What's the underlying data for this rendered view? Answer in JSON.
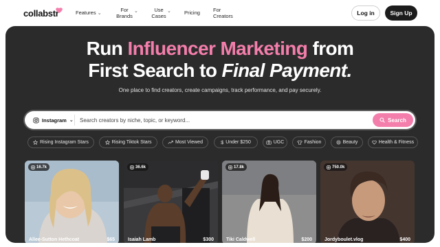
{
  "brand": {
    "name": "collabstr"
  },
  "nav": {
    "items": [
      {
        "label": "Features",
        "has_dropdown": true
      },
      {
        "label": "For\nBrands",
        "has_dropdown": true
      },
      {
        "label": "Use\nCases",
        "has_dropdown": true
      },
      {
        "label": "Pricing",
        "has_dropdown": false
      },
      {
        "label": "For\nCreators",
        "has_dropdown": false
      }
    ],
    "login_label": "Log in",
    "signup_label": "Sign Up"
  },
  "hero": {
    "line1_pre": "Run ",
    "line1_highlight": "Influencer Marketing",
    "line1_post": " from",
    "line2_pre": "First Search to ",
    "line2_italic": "Final Payment.",
    "subtitle": "One place to find creators, create campaigns, track performance, and pay securely."
  },
  "search": {
    "platform": "Instagram",
    "placeholder": "Search creators by niche, topic, or keyword...",
    "button_label": "Search"
  },
  "chips": [
    {
      "label": "Rising Instagram Stars",
      "icon": "star-icon"
    },
    {
      "label": "Rising Tiktok Stars",
      "icon": "star-icon"
    },
    {
      "label": "Most Viewed",
      "icon": "trending-icon"
    },
    {
      "label": "Under $250",
      "icon": "dollar-icon"
    },
    {
      "label": "UGC",
      "icon": "camera-icon"
    },
    {
      "label": "Fashion",
      "icon": "shirt-icon"
    },
    {
      "label": "Beauty",
      "icon": "beauty-icon"
    },
    {
      "label": "Health & Fitness",
      "icon": "heart-icon"
    }
  ],
  "creators": [
    {
      "followers": "16.7k",
      "name": "Allee-Sutton Hethcoat",
      "price": "$65"
    },
    {
      "followers": "36.6k",
      "name": "Isaiah Lamb",
      "price": "$300"
    },
    {
      "followers": "17.8k",
      "name": "Tiki Caldwell",
      "price": "$200"
    },
    {
      "followers": "750.0k",
      "name": "Jordyboulet.vlog",
      "price": "$400"
    }
  ],
  "colors": {
    "accent": "#f47eab",
    "hero_bg": "#2b2b2b",
    "dark_button": "#1c1c1c"
  }
}
